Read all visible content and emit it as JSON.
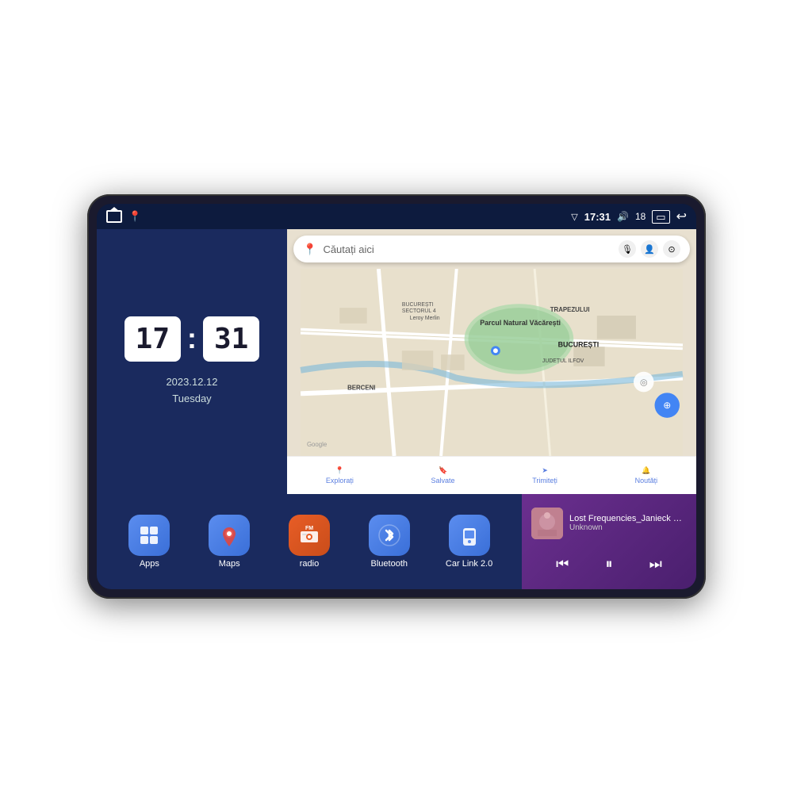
{
  "device": {
    "screen_bg": "#0d1b3e"
  },
  "status_bar": {
    "signal_icon": "▽",
    "time": "17:31",
    "volume_icon": "🔊",
    "volume_level": "18",
    "battery_icon": "▭",
    "back_icon": "↩"
  },
  "clock": {
    "hours": "17",
    "minutes": "31",
    "date": "2023.12.12",
    "day": "Tuesday"
  },
  "map": {
    "search_placeholder": "Căutați aici",
    "nav_items": [
      {
        "label": "Explorați",
        "icon": "📍"
      },
      {
        "label": "Salvate",
        "icon": "🔖"
      },
      {
        "label": "Trimiteți",
        "icon": "➤"
      },
      {
        "label": "Noutăți",
        "icon": "🔔"
      }
    ],
    "location_labels": [
      "TRAPEZULUI",
      "BUCUREȘTI",
      "JUDEȚUL ILFOV",
      "BERCENI"
    ]
  },
  "apps": [
    {
      "id": "apps",
      "label": "Apps",
      "icon": "⊞",
      "color_class": "app-icon-apps"
    },
    {
      "id": "maps",
      "label": "Maps",
      "icon": "📍",
      "color_class": "app-icon-maps"
    },
    {
      "id": "radio",
      "label": "radio",
      "icon": "📻",
      "color_class": "app-icon-radio"
    },
    {
      "id": "bluetooth",
      "label": "Bluetooth",
      "icon": "✦",
      "color_class": "app-icon-bluetooth"
    },
    {
      "id": "carlink",
      "label": "Car Link 2.0",
      "icon": "📱",
      "color_class": "app-icon-carlink"
    }
  ],
  "music": {
    "title": "Lost Frequencies_Janieck Devy-...",
    "artist": "Unknown",
    "prev_icon": "⏮",
    "play_icon": "⏸",
    "next_icon": "⏭"
  }
}
